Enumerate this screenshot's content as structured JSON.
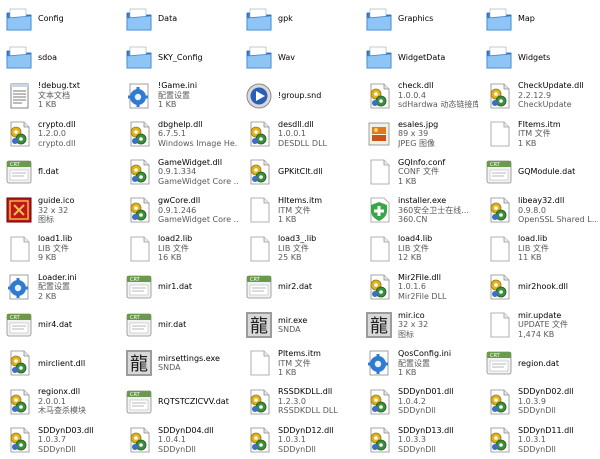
{
  "items": [
    {
      "name": "Config",
      "icon": "folder-icon"
    },
    {
      "name": "Data",
      "icon": "folder-icon"
    },
    {
      "name": "gpk",
      "icon": "folder-icon"
    },
    {
      "name": "Graphics",
      "icon": "folder-icon"
    },
    {
      "name": "Map",
      "icon": "folder-icon"
    },
    {
      "name": "sdoa",
      "icon": "folder-icon"
    },
    {
      "name": "SKY_Config",
      "icon": "folder-icon"
    },
    {
      "name": "Wav",
      "icon": "folder-icon"
    },
    {
      "name": "WidgetData",
      "icon": "folder-icon"
    },
    {
      "name": "Widgets",
      "icon": "folder-icon"
    },
    {
      "name": "!debug.txt",
      "l2": "文本文档",
      "l3": "1 KB",
      "icon": "text-document-icon"
    },
    {
      "name": "!Game.ini",
      "l2": "配置设置",
      "l3": "1 KB",
      "icon": "config-settings-icon"
    },
    {
      "name": "!group.snd",
      "icon": "media-player-icon"
    },
    {
      "name": "check.dll",
      "l2": "1.0.0.4",
      "l3": "sdHardwa 动态链接库",
      "icon": "dll-gear-icon"
    },
    {
      "name": "CheckUpdate.dll",
      "l2": "2.2.12.9",
      "l3": "CheckUpdate",
      "icon": "dll-gear-icon"
    },
    {
      "name": "crypto.dll",
      "l2": "1.2.0.0",
      "l3": "crypto.dll",
      "icon": "dll-gear-icon"
    },
    {
      "name": "dbghelp.dll",
      "l2": "6.7.5.1",
      "l3": "Windows Image He...",
      "icon": "dll-gear-icon"
    },
    {
      "name": "desdll.dll",
      "l2": "1.0.0.1",
      "l3": "DESDLL DLL",
      "icon": "dll-gear-icon"
    },
    {
      "name": "esales.jpg",
      "l2": "89 x 39",
      "l3": "JPEG 图像",
      "icon": "image-icon"
    },
    {
      "name": "FItems.itm",
      "l2": "ITM 文件",
      "l3": "1 KB",
      "icon": "blank-file-icon"
    },
    {
      "name": "fl.dat",
      "icon": "dat-file-icon"
    },
    {
      "name": "GameWidget.dll",
      "l2": "0.9.1.334",
      "l3": "GameWidget Core ...",
      "icon": "dll-gear-icon"
    },
    {
      "name": "GPKitClt.dll",
      "icon": "dll-gear-icon"
    },
    {
      "name": "GQInfo.conf",
      "l2": "CONF 文件",
      "l3": "1 KB",
      "icon": "blank-file-icon"
    },
    {
      "name": "GQModule.dat",
      "icon": "dat-file-icon"
    },
    {
      "name": "guide.ico",
      "l2": "32 x 32",
      "l3": "图标",
      "icon": "guide-red-icon"
    },
    {
      "name": "gwCore.dll",
      "l2": "0.9.1.246",
      "l3": "GameWidget Core ...",
      "icon": "dll-gear-icon"
    },
    {
      "name": "HItems.itm",
      "l2": "ITM 文件",
      "l3": "1 KB",
      "icon": "blank-file-icon"
    },
    {
      "name": "installer.exe",
      "l2": "360安全卫士在线...",
      "l3": "360.CN",
      "icon": "installer-shield-icon"
    },
    {
      "name": "libeay32.dll",
      "l2": "0.9.8.0",
      "l3": "OpenSSL Shared L...",
      "icon": "dll-gear-icon"
    },
    {
      "name": "load1.lib",
      "l2": "LIB 文件",
      "l3": "9 KB",
      "icon": "blank-file-icon"
    },
    {
      "name": "load2.lib",
      "l2": "LIB 文件",
      "l3": "16 KB",
      "icon": "blank-file-icon"
    },
    {
      "name": "load3_.lib",
      "l2": "LIB 文件",
      "l3": "25 KB",
      "icon": "blank-file-icon"
    },
    {
      "name": "load4.lib",
      "l2": "LIB 文件",
      "l3": "12 KB",
      "icon": "blank-file-icon"
    },
    {
      "name": "load.lib",
      "l2": "LIB 文件",
      "l3": "11 KB",
      "icon": "blank-file-icon"
    },
    {
      "name": "Loader.ini",
      "l2": "配置设置",
      "l3": "2 KB",
      "icon": "config-settings-icon"
    },
    {
      "name": "mir1.dat",
      "icon": "dat-file-icon"
    },
    {
      "name": "mir2.dat",
      "icon": "dat-file-icon"
    },
    {
      "name": "Mir2File.dll",
      "l2": "1.0.1.6",
      "l3": "Mir2File DLL",
      "icon": "dll-gear-icon"
    },
    {
      "name": "mir2hook.dll",
      "icon": "dll-gear-icon"
    },
    {
      "name": "mir4.dat",
      "icon": "dat-file-icon"
    },
    {
      "name": "mir.dat",
      "icon": "dat-file-icon"
    },
    {
      "name": "mir.exe",
      "l2": "SNDA",
      "icon": "dragon-app-icon"
    },
    {
      "name": "mir.ico",
      "l2": "32 x 32",
      "l3": "图标",
      "icon": "dragon-app-icon"
    },
    {
      "name": "mir.update",
      "l2": "UPDATE 文件",
      "l3": "1,474 KB",
      "icon": "blank-file-icon"
    },
    {
      "name": "mirclient.dll",
      "icon": "dll-gear-icon"
    },
    {
      "name": "mirsettings.exe",
      "l2": "SNDA",
      "icon": "dragon-app-icon"
    },
    {
      "name": "PItems.itm",
      "l2": "ITM 文件",
      "l3": "1 KB",
      "icon": "blank-file-icon"
    },
    {
      "name": "QosConfig.ini",
      "l2": "配置设置",
      "l3": "1 KB",
      "icon": "config-settings-icon"
    },
    {
      "name": "region.dat",
      "icon": "dat-file-icon"
    },
    {
      "name": "regionx.dll",
      "l2": "2.0.0.1",
      "l3": "木马查杀模块",
      "icon": "dll-gear-icon"
    },
    {
      "name": "RQTSTCZICVV.dat",
      "icon": "dat-file-icon"
    },
    {
      "name": "RSSDKDLL.dll",
      "l2": "1.2.3.0",
      "l3": "RSSDKDLL DLL",
      "icon": "dll-gear-icon"
    },
    {
      "name": "SDDynD01.dll",
      "l2": "1.0.4.2",
      "l3": "SDDynDll",
      "icon": "dll-gear-icon"
    },
    {
      "name": "SDDynD02.dll",
      "l2": "1.0.3.9",
      "l3": "SDDynDll",
      "icon": "dll-gear-icon"
    },
    {
      "name": "SDDynD03.dll",
      "l2": "1.0.3.7",
      "l3": "SDDynDll",
      "icon": "dll-gear-icon"
    },
    {
      "name": "SDDynD04.dll",
      "l2": "1.0.4.1",
      "l3": "SDDynDll",
      "icon": "dll-gear-icon"
    },
    {
      "name": "SDDynD12.dll",
      "l2": "1.0.3.1",
      "l3": "SDDynDll",
      "icon": "dll-gear-icon"
    },
    {
      "name": "SDDynD13.dll",
      "l2": "1.0.3.3",
      "l3": "SDDynDll",
      "icon": "dll-gear-icon"
    },
    {
      "name": "SDDynD11.dll",
      "l2": "1.0.3.1",
      "l3": "SDDynDll",
      "icon": "dll-gear-icon"
    }
  ],
  "colors": {
    "folder_back": "#3a7fd6",
    "folder_front": "#8ec5f5",
    "gear_blue": "#2f7bd0",
    "dat_green": "#6c9a4c",
    "guide_red": "#c0171c",
    "shield_green": "#3aa64a"
  }
}
